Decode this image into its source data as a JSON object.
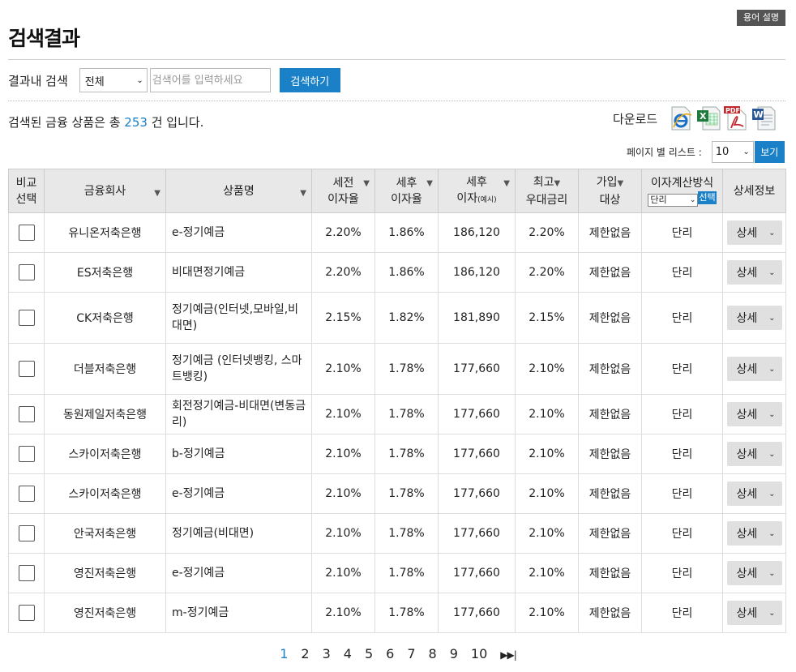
{
  "header": {
    "term_button": "용어 설명",
    "title": "검색결과"
  },
  "search": {
    "label": "결과내 검색",
    "scope_value": "전체",
    "placeholder": "검색어를 입력하세요",
    "value": "",
    "button": "검색하기"
  },
  "result": {
    "prefix": "검색된 금융 상품은 총 ",
    "count": "253",
    "suffix": " 건 입니다."
  },
  "download": {
    "label": "다운로드",
    "icons": [
      "ie-icon",
      "excel-icon",
      "pdf-icon",
      "word-icon"
    ]
  },
  "perpage": {
    "label": "페이지 별 리스트 :",
    "value": "10",
    "button": "보기"
  },
  "table": {
    "headers": {
      "compare_1": "비교",
      "compare_2": "선택",
      "company": "금융회사",
      "product": "상품명",
      "pretax_1": "세전",
      "pretax_2": "이자율",
      "aftertax_1": "세후",
      "aftertax_2": "이자율",
      "interest_1": "세후",
      "interest_2": "이자",
      "interest_note": "(예시)",
      "max_1": "최고",
      "max_2": "우대금리",
      "join_1": "가입",
      "join_2": "대상",
      "calc": "이자계산방식",
      "calc_select": "단리",
      "calc_button": "선택",
      "detail": "상세정보"
    },
    "detail_label": "상세",
    "rows": [
      {
        "company": "유니온저축은행",
        "product": "e-정기예금",
        "pretax": "2.20%",
        "aftertax": "1.86%",
        "interest": "186,120",
        "max": "2.20%",
        "join": "제한없음",
        "calc": "단리"
      },
      {
        "company": "ES저축은행",
        "product": "비대면정기예금",
        "pretax": "2.20%",
        "aftertax": "1.86%",
        "interest": "186,120",
        "max": "2.20%",
        "join": "제한없음",
        "calc": "단리"
      },
      {
        "company": "CK저축은행",
        "product": "정기예금(인터넷,모바일,비대면)",
        "pretax": "2.15%",
        "aftertax": "1.82%",
        "interest": "181,890",
        "max": "2.15%",
        "join": "제한없음",
        "calc": "단리"
      },
      {
        "company": "더블저축은행",
        "product": "정기예금 (인터넷뱅킹, 스마트뱅킹)",
        "pretax": "2.10%",
        "aftertax": "1.78%",
        "interest": "177,660",
        "max": "2.10%",
        "join": "제한없음",
        "calc": "단리"
      },
      {
        "company": "동원제일저축은행",
        "product": "회전정기예금-비대면(변동금리)",
        "pretax": "2.10%",
        "aftertax": "1.78%",
        "interest": "177,660",
        "max": "2.10%",
        "join": "제한없음",
        "calc": "단리"
      },
      {
        "company": "스카이저축은행",
        "product": "b-정기예금",
        "pretax": "2.10%",
        "aftertax": "1.78%",
        "interest": "177,660",
        "max": "2.10%",
        "join": "제한없음",
        "calc": "단리"
      },
      {
        "company": "스카이저축은행",
        "product": "e-정기예금",
        "pretax": "2.10%",
        "aftertax": "1.78%",
        "interest": "177,660",
        "max": "2.10%",
        "join": "제한없음",
        "calc": "단리"
      },
      {
        "company": "안국저축은행",
        "product": "정기예금(비대면)",
        "pretax": "2.10%",
        "aftertax": "1.78%",
        "interest": "177,660",
        "max": "2.10%",
        "join": "제한없음",
        "calc": "단리"
      },
      {
        "company": "영진저축은행",
        "product": "e-정기예금",
        "pretax": "2.10%",
        "aftertax": "1.78%",
        "interest": "177,660",
        "max": "2.10%",
        "join": "제한없음",
        "calc": "단리"
      },
      {
        "company": "영진저축은행",
        "product": "m-정기예금",
        "pretax": "2.10%",
        "aftertax": "1.78%",
        "interest": "177,660",
        "max": "2.10%",
        "join": "제한없음",
        "calc": "단리"
      }
    ]
  },
  "pagination": {
    "pages": [
      "1",
      "2",
      "3",
      "4",
      "5",
      "6",
      "7",
      "8",
      "9",
      "10"
    ],
    "current": "1",
    "next_last": "▶▶|"
  },
  "colors": {
    "accent": "#1a80c7",
    "header_bg": "#e8e8e8",
    "term_button_bg": "#555555"
  }
}
